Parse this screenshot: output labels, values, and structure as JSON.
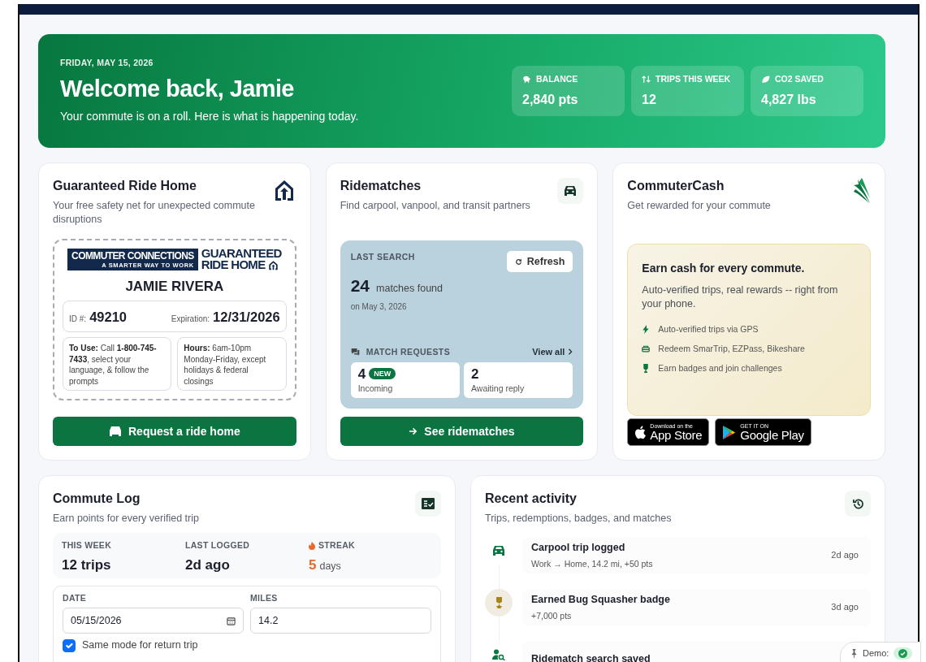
{
  "hero": {
    "date": "FRIDAY, MAY 15, 2026",
    "title": "Welcome back, Jamie",
    "subtitle": "Your commute is on a roll. Here is what is happening today.",
    "stats": [
      {
        "kind": "balance",
        "label": "BALANCE",
        "value": "2,840 pts"
      },
      {
        "kind": "trips",
        "label": "TRIPS THIS WEEK",
        "value": "12"
      },
      {
        "kind": "co2",
        "label": "CO2 SAVED",
        "value": "4,827 lbs"
      }
    ]
  },
  "guaranteed_ride_home": {
    "title": "Guaranteed Ride Home",
    "subtitle": "Your free safety net for unexpected commute disruptions",
    "member_card": {
      "logo_name": "COMMUTER CONNECTIONS",
      "logo_tagline": "A SMARTER WAY TO WORK",
      "program_lines": [
        "GUARANTEED",
        "RIDE HOME"
      ],
      "member_name": "JAMIE RIVERA",
      "id_label": "ID #:",
      "id": "49210",
      "expiration_label": "Expiration:",
      "expiration": "12/31/2026",
      "instructions": "**To Use:** Call **1-800-745-7433**, select your language, & follow the prompts",
      "hours": "**Hours:** 6am-10pm Monday-Friday, except holidays & federal closings"
    },
    "button": "Request a ride home"
  },
  "ridematches": {
    "title": "Ridematches",
    "subtitle": "Find carpool, vanpool, and transit partners",
    "last_search": {
      "label": "LAST SEARCH",
      "refresh": "Refresh",
      "count": "24",
      "count_label": "matches found",
      "date": "on May 3, 2026"
    },
    "requests": {
      "label": "MATCH REQUESTS",
      "view_all": "View all",
      "items": [
        {
          "count": "4",
          "badge": "NEW",
          "label": "Incoming"
        },
        {
          "count": "2",
          "label": "Awaiting reply"
        }
      ]
    },
    "button": "See ridematches"
  },
  "commuter_cash": {
    "title": "CommuterCash",
    "subtitle": "Get rewarded for your commute",
    "promo": {
      "heading": "Earn cash for every commute.",
      "text": "Auto-verified trips, real rewards -- right from your phone.",
      "features": [
        {
          "kind": "gps",
          "text": "Auto-verified trips via GPS"
        },
        {
          "kind": "redeem",
          "text": "Redeem SmarTrip, EZPass, Bikeshare"
        },
        {
          "kind": "badges",
          "text": "Earn badges and join challenges"
        }
      ]
    },
    "stores": [
      {
        "kind": "apple",
        "small": "Download on the",
        "name": "App Store"
      },
      {
        "kind": "google",
        "small": "GET IT ON",
        "name": "Google Play"
      }
    ]
  },
  "commute_log": {
    "title": "Commute Log",
    "subtitle": "Earn points for every verified trip",
    "stats": [
      {
        "kind": "plain",
        "label": "THIS WEEK",
        "value": "12 trips"
      },
      {
        "kind": "plain",
        "label": "LAST LOGGED",
        "value": "2d ago"
      },
      {
        "kind": "streak",
        "label": "STREAK",
        "value": "5",
        "unit": "days"
      }
    ],
    "form": {
      "date_label": "DATE",
      "date": "05/15/2026",
      "miles_label": "MILES",
      "miles": "14.2",
      "return_trip": {
        "label": "Same mode for return trip",
        "checked": true
      }
    }
  },
  "recent_activity": {
    "title": "Recent activity",
    "subtitle": "Trips, redemptions, badges, and matches",
    "items": [
      {
        "kind": "carpool",
        "title": "Carpool trip logged",
        "detail": "Work → Home, 14.2 mi, +50 pts",
        "time": "2d ago"
      },
      {
        "kind": "badge",
        "title": "Earned Bug Squasher badge",
        "detail": "+7,000 pts",
        "time": "3d ago"
      },
      {
        "kind": "ridematch",
        "title": "Ridematch search saved"
      }
    ]
  },
  "demo_widget": {
    "label": "Demo:"
  }
}
